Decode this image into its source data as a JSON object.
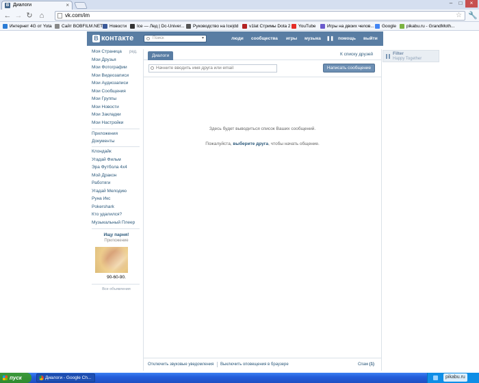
{
  "browser": {
    "tab_title": "Диалоги",
    "url": "vk.com/im",
    "bookmarks": [
      {
        "label": "Интернет 4G от Yota",
        "color": "#2a7bd5"
      },
      {
        "label": "Сайт BOBFILM.NET",
        "color": "#888888"
      },
      {
        "label": "Новости",
        "color": "#3b5998"
      },
      {
        "label": "Ice — Лед | Dc-Univer...",
        "color": "#333333"
      },
      {
        "label": "Руководство на Ice|dd",
        "color": "#555555"
      },
      {
        "label": "v1lat Стримы Dota 2",
        "color": "#b22222"
      },
      {
        "label": "YouTube",
        "color": "#e52d27"
      },
      {
        "label": "Игры на двоих челов...",
        "color": "#6a5acd"
      },
      {
        "label": "Google",
        "color": "#4285f4"
      },
      {
        "label": "pikabu.ru - GrandMoth...",
        "color": "#7cb342"
      }
    ]
  },
  "vk": {
    "logo": "контакте",
    "logo_letter": "В",
    "search_placeholder": "Поиск",
    "nav": [
      "люди",
      "сообщества",
      "игры",
      "музыка",
      "помощь",
      "выйти"
    ],
    "left_menu": [
      "Моя Страница",
      "Мои Друзья",
      "Мои Фотографии",
      "Мои Видеозаписи",
      "Мои Аудиозаписи",
      "Мои Сообщения",
      "Мои Группы",
      "Мои Новости",
      "Мои Закладки",
      "Мои Настройки"
    ],
    "edit_label": "ред.",
    "left_menu_2": [
      "Приложения",
      "Документы"
    ],
    "apps": [
      "Клондайк",
      "Угадай Фильм",
      "Эра Футбола 4x4",
      "Мой Дракон",
      "Работяги",
      "Угадай Мелодию",
      "Руна Икс",
      "Pokershark",
      "Кто удалился?",
      "Музыкальный Плеер"
    ],
    "ad": {
      "title": "Ищу парня!",
      "subtitle": "Приложение",
      "text": "90-60-90.",
      "all_ads": "Все объявления"
    },
    "dialogs": {
      "tab": "Диалоги",
      "to_friends": "К списку друзей",
      "input_placeholder": "Начните вводить имя друга или email",
      "write_button": "Написать сообщение",
      "empty_line1": "Здесь будет выводиться список Ваших сообщений.",
      "empty_prefix": "Пожалуйста, ",
      "empty_link": "выберите друга",
      "empty_suffix": ", чтобы начать общение."
    },
    "footer": {
      "sound_off": "Отключить звуковые уведомления",
      "browser_notif_off": "Выключить оповещения в браузере",
      "spam_label": "Спам",
      "spam_count": "(1)"
    },
    "player": {
      "title": "Filter",
      "subtitle": "Happy Together"
    }
  },
  "taskbar": {
    "start": "пуск",
    "item": "Диалоги - Google Ch...",
    "watermark": "pikabu.ru"
  }
}
